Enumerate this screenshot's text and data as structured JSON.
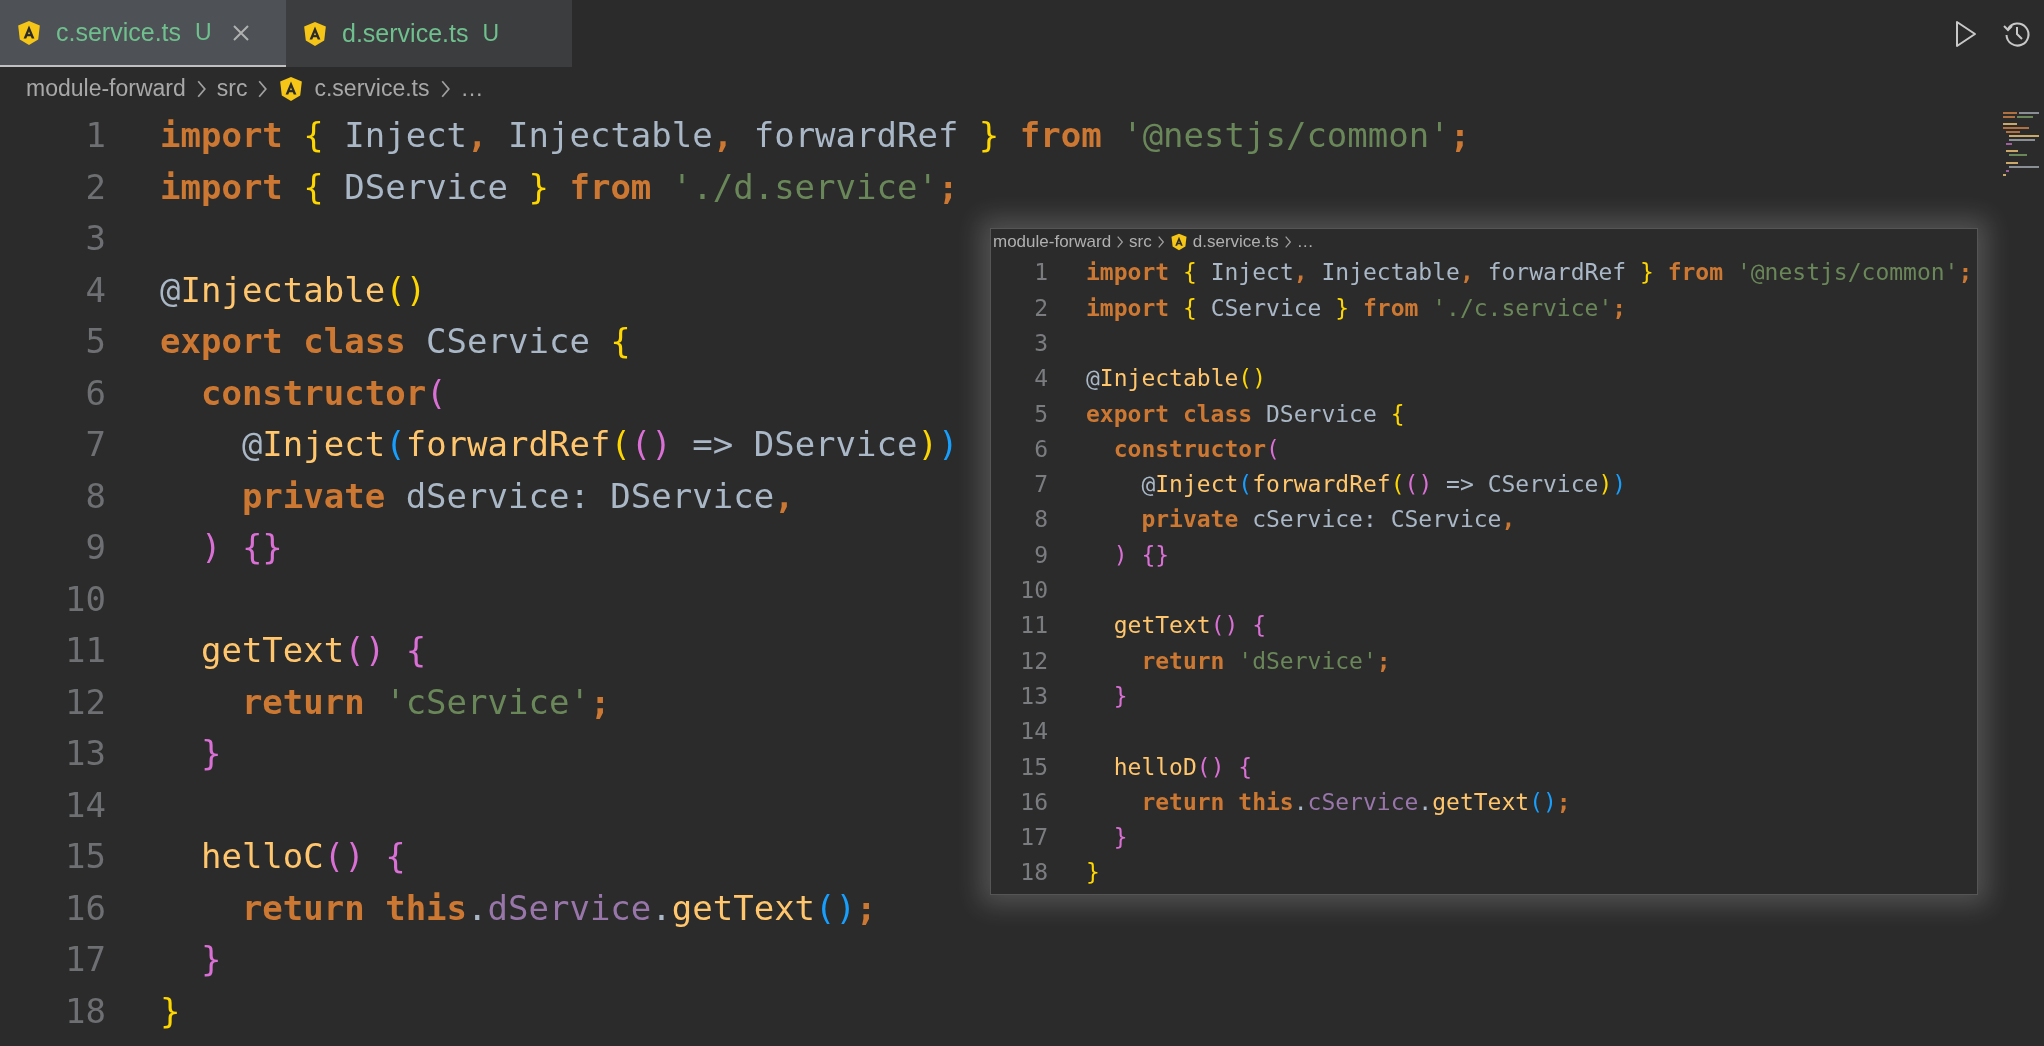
{
  "tabs": [
    {
      "label": "c.service.ts",
      "status": "U",
      "selected": true
    },
    {
      "label": "d.service.ts",
      "status": "U",
      "selected": false
    }
  ],
  "breadcrumbs": [
    {
      "label": "module-forward",
      "kind": "folder"
    },
    {
      "label": "src",
      "kind": "folder"
    },
    {
      "label": "c.service.ts",
      "kind": "file"
    },
    {
      "label": "…",
      "kind": "more"
    }
  ],
  "editor": {
    "lines": [
      {
        "number": "1",
        "tokens": [
          {
            "kind": "kw",
            "text": "import "
          },
          {
            "kind": "b1",
            "text": "{"
          },
          {
            "kind": "id",
            "text": " Inject"
          },
          {
            "kind": "kw",
            "text": ","
          },
          {
            "kind": "id",
            "text": " Injectable"
          },
          {
            "kind": "kw",
            "text": ","
          },
          {
            "kind": "id",
            "text": " forwardRef "
          },
          {
            "kind": "b1",
            "text": "}"
          },
          {
            "kind": "kw",
            "text": " from "
          },
          {
            "kind": "str",
            "text": "'@nestjs/common'"
          },
          {
            "kind": "kw",
            "text": ";"
          }
        ]
      },
      {
        "number": "2",
        "tokens": [
          {
            "kind": "kw",
            "text": "import "
          },
          {
            "kind": "b1",
            "text": "{"
          },
          {
            "kind": "id",
            "text": " DService "
          },
          {
            "kind": "b1",
            "text": "}"
          },
          {
            "kind": "kw",
            "text": " from "
          },
          {
            "kind": "str",
            "text": "'./d.service'"
          },
          {
            "kind": "kw",
            "text": ";"
          }
        ]
      },
      {
        "number": "3"
      },
      {
        "number": "4",
        "tokens": [
          {
            "kind": "id",
            "text": "@"
          },
          {
            "kind": "fn",
            "text": "Injectable"
          },
          {
            "kind": "b1",
            "text": "()"
          }
        ]
      },
      {
        "number": "5",
        "tokens": [
          {
            "kind": "kw",
            "text": "export class "
          },
          {
            "kind": "id",
            "text": "CService "
          },
          {
            "kind": "b1",
            "text": "{"
          }
        ]
      },
      {
        "number": "6",
        "tokens": [
          {
            "kind": "kw",
            "text": "  constructor"
          },
          {
            "kind": "b2",
            "text": "("
          }
        ]
      },
      {
        "number": "7",
        "tokens": [
          {
            "kind": "id",
            "text": "    @"
          },
          {
            "kind": "fn",
            "text": "Inject"
          },
          {
            "kind": "b3",
            "text": "("
          },
          {
            "kind": "fn",
            "text": "forwardRef"
          },
          {
            "kind": "b1",
            "text": "("
          },
          {
            "kind": "b2",
            "text": "()"
          },
          {
            "kind": "id",
            "text": " => DService"
          },
          {
            "kind": "b1",
            "text": ")"
          },
          {
            "kind": "b3",
            "text": ")"
          }
        ]
      },
      {
        "number": "8",
        "tokens": [
          {
            "kind": "kw",
            "text": "    private "
          },
          {
            "kind": "id",
            "text": "dService: DService"
          },
          {
            "kind": "kw",
            "text": ","
          }
        ]
      },
      {
        "number": "9",
        "tokens": [
          {
            "kind": "b2",
            "text": "  ) {}"
          }
        ]
      },
      {
        "number": "10"
      },
      {
        "number": "11",
        "tokens": [
          {
            "kind": "fn",
            "text": "  getText"
          },
          {
            "kind": "b2",
            "text": "() {"
          }
        ]
      },
      {
        "number": "12",
        "tokens": [
          {
            "kind": "kw",
            "text": "    return "
          },
          {
            "kind": "str",
            "text": "'cService'"
          },
          {
            "kind": "kw",
            "text": ";"
          }
        ]
      },
      {
        "number": "13",
        "tokens": [
          {
            "kind": "b2",
            "text": "  }"
          }
        ]
      },
      {
        "number": "14"
      },
      {
        "number": "15",
        "tokens": [
          {
            "kind": "fn",
            "text": "  helloC"
          },
          {
            "kind": "b2",
            "text": "() {"
          }
        ]
      },
      {
        "number": "16",
        "tokens": [
          {
            "kind": "kw",
            "text": "    return this"
          },
          {
            "kind": "id",
            "text": "."
          },
          {
            "kind": "prop",
            "text": "dService"
          },
          {
            "kind": "id",
            "text": "."
          },
          {
            "kind": "fn",
            "text": "getText"
          },
          {
            "kind": "b3",
            "text": "()"
          },
          {
            "kind": "kw",
            "text": ";"
          }
        ]
      },
      {
        "number": "17",
        "tokens": [
          {
            "kind": "b2",
            "text": "  }"
          }
        ]
      },
      {
        "number": "18",
        "tokens": [
          {
            "kind": "b1",
            "text": "}"
          }
        ]
      }
    ]
  },
  "peek": {
    "breadcrumbs": [
      {
        "label": "module-forward",
        "kind": "folder"
      },
      {
        "label": "src",
        "kind": "folder"
      },
      {
        "label": "d.service.ts",
        "kind": "file"
      },
      {
        "label": "…",
        "kind": "more"
      }
    ],
    "lines": [
      {
        "number": "1",
        "tokens": [
          {
            "kind": "kw",
            "text": "import "
          },
          {
            "kind": "b1",
            "text": "{"
          },
          {
            "kind": "id",
            "text": " Inject"
          },
          {
            "kind": "kw",
            "text": ","
          },
          {
            "kind": "id",
            "text": " Injectable"
          },
          {
            "kind": "kw",
            "text": ","
          },
          {
            "kind": "id",
            "text": " forwardRef "
          },
          {
            "kind": "b1",
            "text": "}"
          },
          {
            "kind": "kw",
            "text": " from "
          },
          {
            "kind": "str",
            "text": "'@nestjs/common'"
          },
          {
            "kind": "kw",
            "text": ";"
          }
        ]
      },
      {
        "number": "2",
        "tokens": [
          {
            "kind": "kw",
            "text": "import "
          },
          {
            "kind": "b1",
            "text": "{"
          },
          {
            "kind": "id",
            "text": " CService "
          },
          {
            "kind": "b1",
            "text": "}"
          },
          {
            "kind": "kw",
            "text": " from "
          },
          {
            "kind": "str",
            "text": "'./c.service'"
          },
          {
            "kind": "kw",
            "text": ";"
          }
        ]
      },
      {
        "number": "3"
      },
      {
        "number": "4",
        "tokens": [
          {
            "kind": "id",
            "text": "@"
          },
          {
            "kind": "fn",
            "text": "Injectable"
          },
          {
            "kind": "b1",
            "text": "()"
          }
        ]
      },
      {
        "number": "5",
        "tokens": [
          {
            "kind": "kw",
            "text": "export class "
          },
          {
            "kind": "id",
            "text": "DService "
          },
          {
            "kind": "b1",
            "text": "{"
          }
        ]
      },
      {
        "number": "6",
        "tokens": [
          {
            "kind": "kw",
            "text": "  constructor"
          },
          {
            "kind": "b2",
            "text": "("
          }
        ]
      },
      {
        "number": "7",
        "tokens": [
          {
            "kind": "id",
            "text": "    @"
          },
          {
            "kind": "fn",
            "text": "Inject"
          },
          {
            "kind": "b3",
            "text": "("
          },
          {
            "kind": "fn",
            "text": "forwardRef"
          },
          {
            "kind": "b1",
            "text": "("
          },
          {
            "kind": "b2",
            "text": "()"
          },
          {
            "kind": "id",
            "text": " => CService"
          },
          {
            "kind": "b1",
            "text": ")"
          },
          {
            "kind": "b3",
            "text": ")"
          }
        ]
      },
      {
        "number": "8",
        "tokens": [
          {
            "kind": "kw",
            "text": "    private "
          },
          {
            "kind": "id",
            "text": "cService: CService"
          },
          {
            "kind": "kw",
            "text": ","
          }
        ]
      },
      {
        "number": "9",
        "tokens": [
          {
            "kind": "b2",
            "text": "  ) {}"
          }
        ]
      },
      {
        "number": "10"
      },
      {
        "number": "11",
        "tokens": [
          {
            "kind": "fn",
            "text": "  getText"
          },
          {
            "kind": "b2",
            "text": "() {"
          }
        ]
      },
      {
        "number": "12",
        "tokens": [
          {
            "kind": "kw",
            "text": "    return "
          },
          {
            "kind": "str",
            "text": "'dService'"
          },
          {
            "kind": "kw",
            "text": ";"
          }
        ]
      },
      {
        "number": "13",
        "tokens": [
          {
            "kind": "b2",
            "text": "  }"
          }
        ]
      },
      {
        "number": "14"
      },
      {
        "number": "15",
        "tokens": [
          {
            "kind": "fn",
            "text": "  helloD"
          },
          {
            "kind": "b2",
            "text": "() {"
          }
        ]
      },
      {
        "number": "16",
        "tokens": [
          {
            "kind": "kw",
            "text": "    return this"
          },
          {
            "kind": "id",
            "text": "."
          },
          {
            "kind": "prop",
            "text": "cService"
          },
          {
            "kind": "id",
            "text": "."
          },
          {
            "kind": "fn",
            "text": "getText"
          },
          {
            "kind": "b3",
            "text": "()"
          },
          {
            "kind": "kw",
            "text": ";"
          }
        ]
      },
      {
        "number": "17",
        "tokens": [
          {
            "kind": "b2",
            "text": "  }"
          }
        ]
      },
      {
        "number": "18",
        "tokens": [
          {
            "kind": "b1",
            "text": "}"
          }
        ]
      }
    ]
  }
}
